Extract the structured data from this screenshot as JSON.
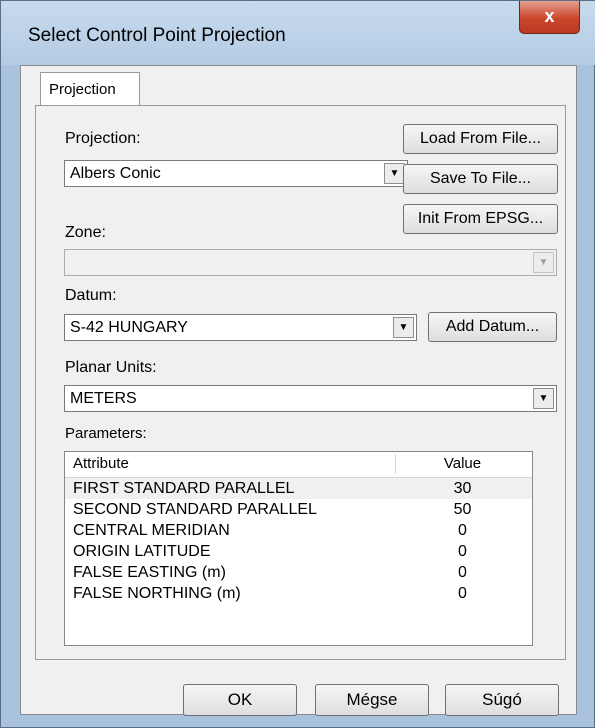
{
  "window": {
    "title": "Select Control Point Projection",
    "close_label": "x"
  },
  "tabs": [
    {
      "label": "Projection"
    }
  ],
  "projection": {
    "label": "Projection:",
    "value": "Albers Conic"
  },
  "zone": {
    "label": "Zone:",
    "value": ""
  },
  "datum": {
    "label": "Datum:",
    "value": "S-42 HUNGARY"
  },
  "planar_units": {
    "label": "Planar Units:",
    "value": "METERS"
  },
  "buttons": {
    "load": "Load From File...",
    "save": "Save To File...",
    "init": "Init From EPSG...",
    "add_datum": "Add Datum...",
    "ok": "OK",
    "cancel": "Mégse",
    "help": "Súgó"
  },
  "parameters": {
    "label": "Parameters:",
    "columns": [
      "Attribute",
      "Value"
    ],
    "rows": [
      {
        "attribute": "FIRST STANDARD PARALLEL",
        "value": "30"
      },
      {
        "attribute": "SECOND STANDARD PARALLEL",
        "value": "50"
      },
      {
        "attribute": "CENTRAL MERIDIAN",
        "value": "0"
      },
      {
        "attribute": "ORIGIN LATITUDE",
        "value": "0"
      },
      {
        "attribute": "FALSE EASTING (m)",
        "value": "0"
      },
      {
        "attribute": "FALSE NORTHING (m)",
        "value": "0"
      }
    ]
  },
  "icons": {
    "dropdown": "chevron-down-icon",
    "close": "close-icon"
  }
}
